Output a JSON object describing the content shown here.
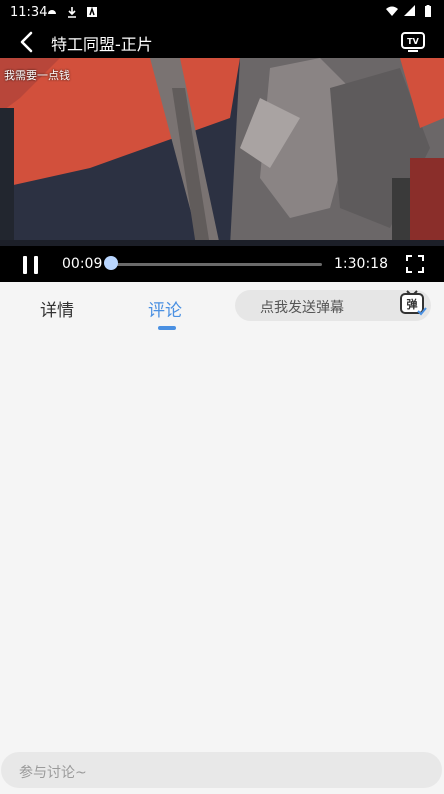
{
  "status_bar": {
    "time": "11:34"
  },
  "header": {
    "title": "特工同盟-正片",
    "tv_icon": "tv-icon",
    "back_icon": "back-arrow-icon"
  },
  "video": {
    "danmaku_text": "我需要一点钱",
    "current_time": "00:09",
    "total_time": "1:30:18",
    "progress": 0.002
  },
  "tabs": [
    {
      "label": "详情",
      "active": false
    },
    {
      "label": "评论",
      "active": true
    }
  ],
  "danmaku_input": {
    "placeholder": "点我发送弹幕",
    "button_label": "弹"
  },
  "comment_input": {
    "placeholder": "参与讨论~"
  },
  "colors": {
    "accent": "#4a90e2",
    "bar_bg": "#000000",
    "page_bg": "#f5f5f5"
  }
}
